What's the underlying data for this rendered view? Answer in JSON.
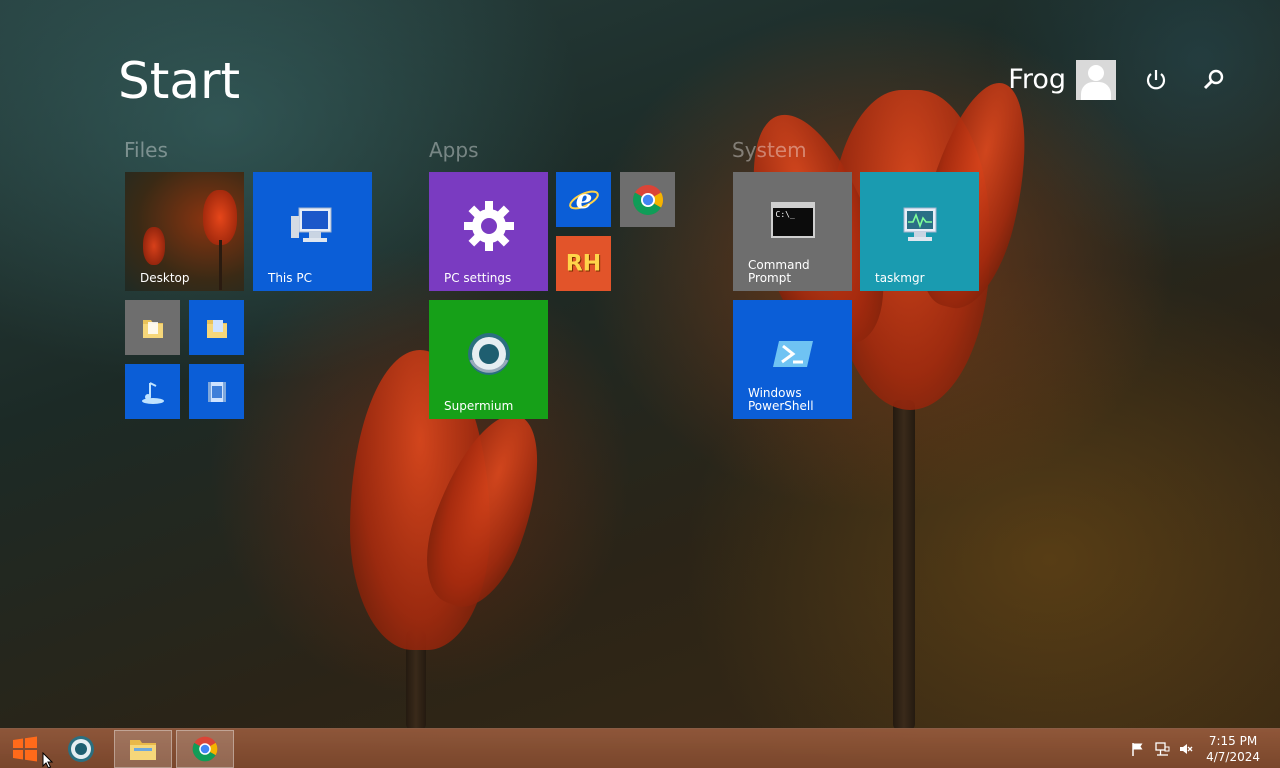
{
  "start": {
    "title": "Start"
  },
  "user": {
    "name": "Frog"
  },
  "groups": {
    "files": "Files",
    "apps": "Apps",
    "system": "System"
  },
  "tiles": {
    "desktop": "Desktop",
    "this_pc": "This PC",
    "pc_settings": "PC settings",
    "supermium": "Supermium",
    "command_prompt": "Command\nPrompt",
    "taskmgr": "taskmgr",
    "powershell": "Windows\nPowerShell",
    "rh_text": "RH",
    "cmd_text": "C:\\_"
  },
  "clock": {
    "time": "7:15 PM",
    "date": "4/7/2024"
  },
  "colors": {
    "blue": "#0b5ed7",
    "purple": "#7a3bc1",
    "green": "#16a018",
    "teal": "#1a9bb0",
    "gray": "#6e6e6e",
    "orange": "#e2542a"
  },
  "icons": {
    "windows_logo": "windows-logo-icon",
    "power": "power-icon",
    "search": "search-icon",
    "gear": "gear-icon",
    "ie": "internet-explorer-icon",
    "chrome": "chrome-icon",
    "folder": "folder-icon",
    "tray_flag": "flag-icon",
    "tray_network": "network-icon",
    "tray_volume": "volume-muted-icon"
  }
}
